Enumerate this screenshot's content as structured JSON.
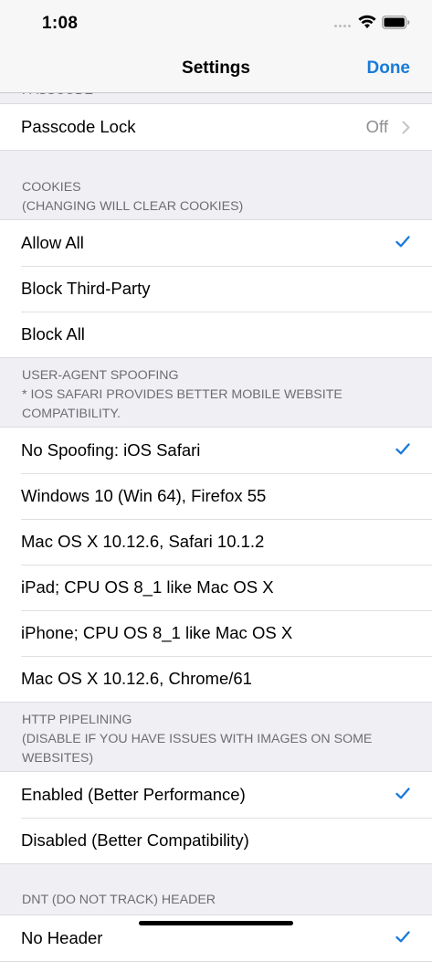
{
  "status_bar": {
    "time": "1:08"
  },
  "nav": {
    "title": "Settings",
    "done_label": "Done"
  },
  "passcode": {
    "header": "PASSCODE",
    "lock_label": "Passcode Lock",
    "lock_value": "Off"
  },
  "cookies": {
    "header": "COOKIES\n(CHANGING WILL CLEAR COOKIES)",
    "options": [
      "Allow All",
      "Block Third-Party",
      "Block All"
    ],
    "selected": "Allow All"
  },
  "user_agent": {
    "header": "USER-AGENT SPOOFING\n* IOS SAFARI PROVIDES BETTER MOBILE WEBSITE COMPATIBILITY.",
    "options": [
      "No Spoofing: iOS Safari",
      "Windows 10 (Win 64), Firefox 55",
      "Mac OS X 10.12.6, Safari 10.1.2",
      "iPad; CPU OS 8_1 like Mac OS X",
      "iPhone; CPU OS 8_1 like Mac OS X",
      "Mac OS X 10.12.6, Chrome/61"
    ],
    "selected": "No Spoofing: iOS Safari"
  },
  "http_pipelining": {
    "header": "HTTP PIPELINING\n(DISABLE IF YOU HAVE ISSUES WITH IMAGES ON SOME WEBSITES)",
    "options": [
      "Enabled (Better Performance)",
      "Disabled (Better Compatibility)"
    ],
    "selected": "Enabled (Better Performance)"
  },
  "dnt": {
    "header": "DNT (DO NOT TRACK) HEADER",
    "options": [
      "No Header"
    ],
    "selected": "No Header"
  },
  "colors": {
    "accent": "#1a7ad9",
    "group_bg": "#efeff4",
    "secondary_text": "#6d6d72"
  },
  "icons": [
    "wifi-icon",
    "battery-icon",
    "checkmark-icon",
    "chevron-right-icon"
  ]
}
